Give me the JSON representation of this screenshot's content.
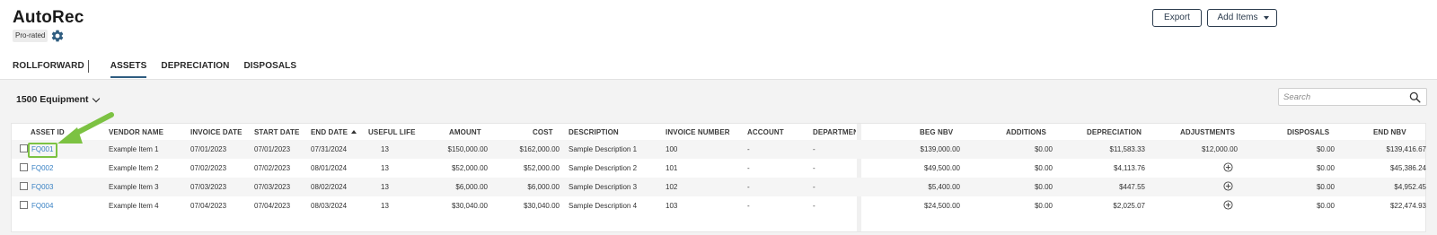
{
  "app": {
    "title": "AutoRec",
    "badge": "Pro-rated",
    "gear_icon": "gear-icon"
  },
  "actions": {
    "export_label": "Export",
    "add_items_label": "Add Items"
  },
  "tabs": [
    {
      "label": "ROLLFORWARD",
      "active": false
    },
    {
      "label": "ASSETS",
      "active": true
    },
    {
      "label": "DEPRECIATION",
      "active": false
    },
    {
      "label": "DISPOSALS",
      "active": false
    }
  ],
  "filter": {
    "account_selected": "1500 Equipment"
  },
  "search": {
    "placeholder": "Search"
  },
  "table": {
    "left_headers": [
      "ASSET ID",
      "VENDOR NAME",
      "INVOICE DATE",
      "START DATE",
      "END DATE",
      "USEFUL LIFE",
      "AMOUNT",
      "COST",
      "DESCRIPTION",
      "INVOICE NUMBER",
      "ACCOUNT",
      "DEPARTMEN"
    ],
    "right_headers": [
      "BEG NBV",
      "ADDITIONS",
      "DEPRECIATION",
      "ADJUSTMENTS",
      "DISPOSALS",
      "END NBV"
    ],
    "sorted_column": "END DATE",
    "rows": [
      {
        "asset_id": "FQ001",
        "vendor": "Example Item 1",
        "invoice_date": "07/01/2023",
        "start_date": "07/01/2023",
        "end_date": "07/31/2024",
        "useful_life": "13",
        "amount": "$150,000.00",
        "cost": "$162,000.00",
        "description": "Sample Description 1",
        "invoice_number": "100",
        "account": "-",
        "department": "-",
        "beg_nbv": "$139,000.00",
        "additions": "$0.00",
        "depreciation": "$11,583.33",
        "adjustments": "$12,000.00",
        "disposals": "$0.00",
        "end_nbv": "$139,416.67"
      },
      {
        "asset_id": "FQ002",
        "vendor": "Example Item 2",
        "invoice_date": "07/02/2023",
        "start_date": "07/02/2023",
        "end_date": "08/01/2024",
        "useful_life": "13",
        "amount": "$52,000.00",
        "cost": "$52,000.00",
        "description": "Sample Description 2",
        "invoice_number": "101",
        "account": "-",
        "department": "-",
        "beg_nbv": "$49,500.00",
        "additions": "$0.00",
        "depreciation": "$4,113.76",
        "adjustments": "",
        "disposals": "$0.00",
        "end_nbv": "$45,386.24"
      },
      {
        "asset_id": "FQ003",
        "vendor": "Example Item 3",
        "invoice_date": "07/03/2023",
        "start_date": "07/03/2023",
        "end_date": "08/02/2024",
        "useful_life": "13",
        "amount": "$6,000.00",
        "cost": "$6,000.00",
        "description": "Sample Description 3",
        "invoice_number": "102",
        "account": "-",
        "department": "-",
        "beg_nbv": "$5,400.00",
        "additions": "$0.00",
        "depreciation": "$447.55",
        "adjustments": "",
        "disposals": "$0.00",
        "end_nbv": "$4,952.45"
      },
      {
        "asset_id": "FQ004",
        "vendor": "Example Item 4",
        "invoice_date": "07/04/2023",
        "start_date": "07/04/2023",
        "end_date": "08/03/2024",
        "useful_life": "13",
        "amount": "$30,040.00",
        "cost": "$30,040.00",
        "description": "Sample Description 4",
        "invoice_number": "103",
        "account": "-",
        "department": "-",
        "beg_nbv": "$24,500.00",
        "additions": "$0.00",
        "depreciation": "$2,025.07",
        "adjustments": "",
        "disposals": "$0.00",
        "end_nbv": "$22,474.93"
      }
    ]
  },
  "colors": {
    "link": "#3a82c4",
    "accent_tab": "#2f5d80",
    "annotation_arrow": "#7cc242"
  }
}
